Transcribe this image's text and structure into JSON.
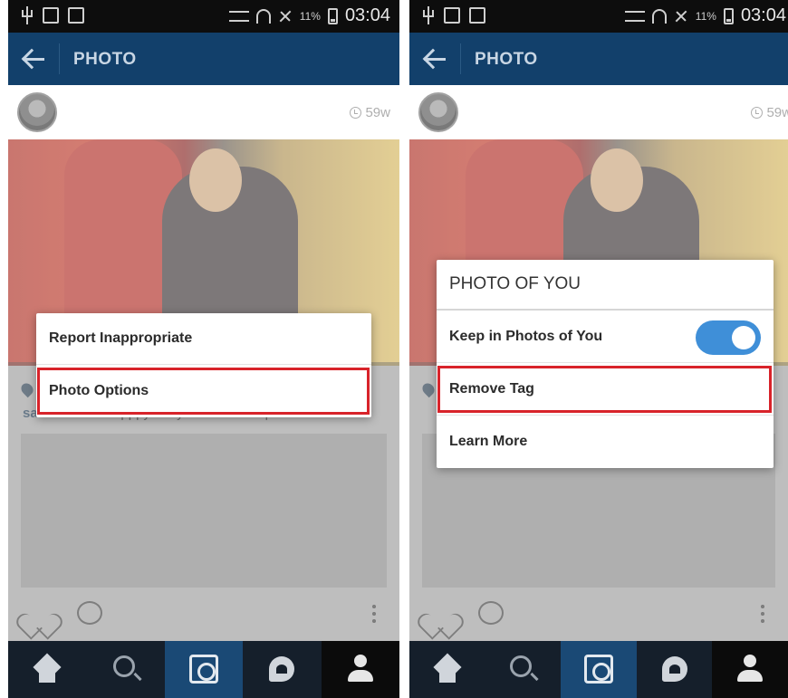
{
  "status_bar": {
    "battery": "11%",
    "time": "03:04"
  },
  "app_bar": {
    "title": "PHOTO"
  },
  "post": {
    "time_ago": "59w",
    "caption_user": "saloni90900",
    "caption_text": " Happpy bday mere kuchhi poooo mere"
  },
  "left_menu": {
    "items": [
      "Report Inappropriate",
      "Photo Options"
    ],
    "highlighted": "Photo Options"
  },
  "right_dialog": {
    "title": "PHOTO OF YOU",
    "keep_label": "Keep in Photos of You",
    "keep_toggle_on": true,
    "remove_label": "Remove Tag",
    "learn_label": "Learn More",
    "highlighted": "Remove Tag"
  },
  "colors": {
    "app_bar": "#12406b",
    "highlight_border": "#d8232a",
    "toggle_on": "#3f8fd8",
    "nav_active": "#1a4975"
  },
  "bottom_nav": {
    "icons": [
      "home-icon",
      "search-icon",
      "camera-icon",
      "activity-icon",
      "profile-icon"
    ],
    "active": "camera-icon"
  }
}
